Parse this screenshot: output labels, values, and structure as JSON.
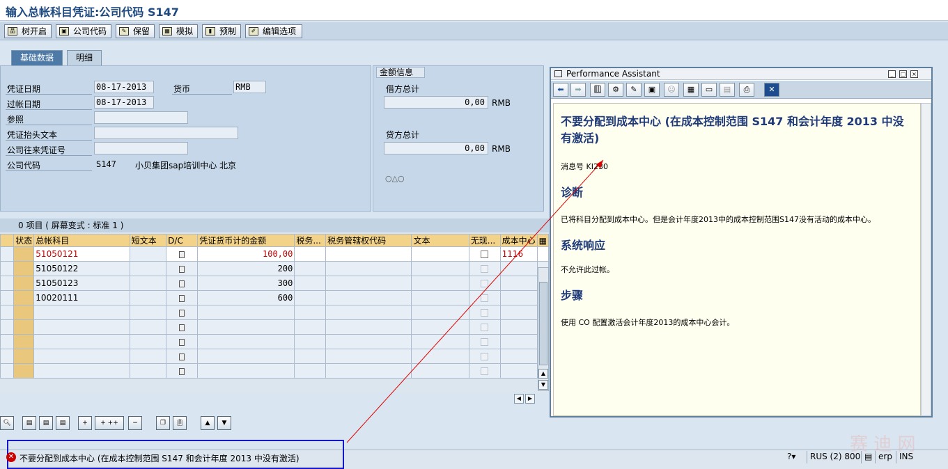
{
  "window": {
    "title": "输入总帐科目凭证:公司代码 S147"
  },
  "toolbar": {
    "buttons": [
      {
        "label": "树开启",
        "icon": "tree-icon"
      },
      {
        "label": "公司代码",
        "icon": "company-icon"
      },
      {
        "label": "保留",
        "icon": "hold-icon"
      },
      {
        "label": "模拟",
        "icon": "simulate-icon"
      },
      {
        "label": "预制",
        "icon": "park-icon"
      },
      {
        "label": "编辑选项",
        "icon": "edit-options-icon"
      }
    ]
  },
  "tabs": [
    {
      "label": "基础数据",
      "active": true
    },
    {
      "label": "明细",
      "active": false
    }
  ],
  "header": {
    "doc_date_label": "凭证日期",
    "doc_date": "08-17-2013",
    "currency_label": "货币",
    "currency": "RMB",
    "post_date_label": "过帐日期",
    "post_date": "08-17-2013",
    "reference_label": "参照",
    "reference": "",
    "header_text_label": "凭证抬头文本",
    "header_text": "",
    "ic_doc_label": "公司往来凭证号",
    "ic_doc": "",
    "company_code_label": "公司代码",
    "company_code": "S147",
    "company_name": "小贝集团sap培训中心 北京"
  },
  "amount_info": {
    "title": "金额信息",
    "debit_label": "借方总计",
    "debit_value": "0,00",
    "debit_currency": "RMB",
    "credit_label": "贷方总计",
    "credit_value": "0,00",
    "credit_currency": "RMB",
    "status_indicator": "○△○"
  },
  "items_table": {
    "header_text": "0 项目 ( 屏幕变式 : 标准 1 )",
    "columns": [
      "状态",
      "总帐科目",
      "短文本",
      "D/C",
      "凭证货币计的金额",
      "税务...",
      "税务管辖权代码",
      "文本",
      "无现...",
      "成本中心"
    ],
    "rows": [
      {
        "account": "51050121",
        "amount": "100,00",
        "cost_center": "1116",
        "error": true
      },
      {
        "account": "51050122",
        "amount": "200",
        "cost_center": "",
        "error": false
      },
      {
        "account": "51050123",
        "amount": "300",
        "cost_center": "",
        "error": false
      },
      {
        "account": "10020111",
        "amount": "600",
        "cost_center": "",
        "error": false
      },
      {
        "account": "",
        "amount": "",
        "cost_center": "",
        "error": false
      },
      {
        "account": "",
        "amount": "",
        "cost_center": "",
        "error": false
      },
      {
        "account": "",
        "amount": "",
        "cost_center": "",
        "error": false
      },
      {
        "account": "",
        "amount": "",
        "cost_center": "",
        "error": false
      },
      {
        "account": "",
        "amount": "",
        "cost_center": "",
        "error": false
      }
    ]
  },
  "performance_assistant": {
    "title": "Performance Assistant",
    "message_title": "不要分配到成本中心 (在成本控制范围 S147 和会计年度 2013 中没有激活)",
    "message_no_label": "消息号",
    "message_no": "KI230",
    "diagnosis_title": "诊断",
    "diagnosis_text": "已将科目分配到成本中心。但是会计年度2013中的成本控制范围S147没有活动的成本中心。",
    "response_title": "系统响应",
    "response_text": "不允许此过帐。",
    "procedure_title": "步骤",
    "procedure_text": "使用  CO 配置激活会计年度2013的成本中心会计。"
  },
  "status_bar": {
    "message": "不要分配到成本中心 (在成本控制范围 S147 和会计年度 2013 中没有激活)",
    "system": "RUS (2) 800",
    "server": "erp",
    "mode": "INS"
  },
  "watermark": "赛 迪 网"
}
